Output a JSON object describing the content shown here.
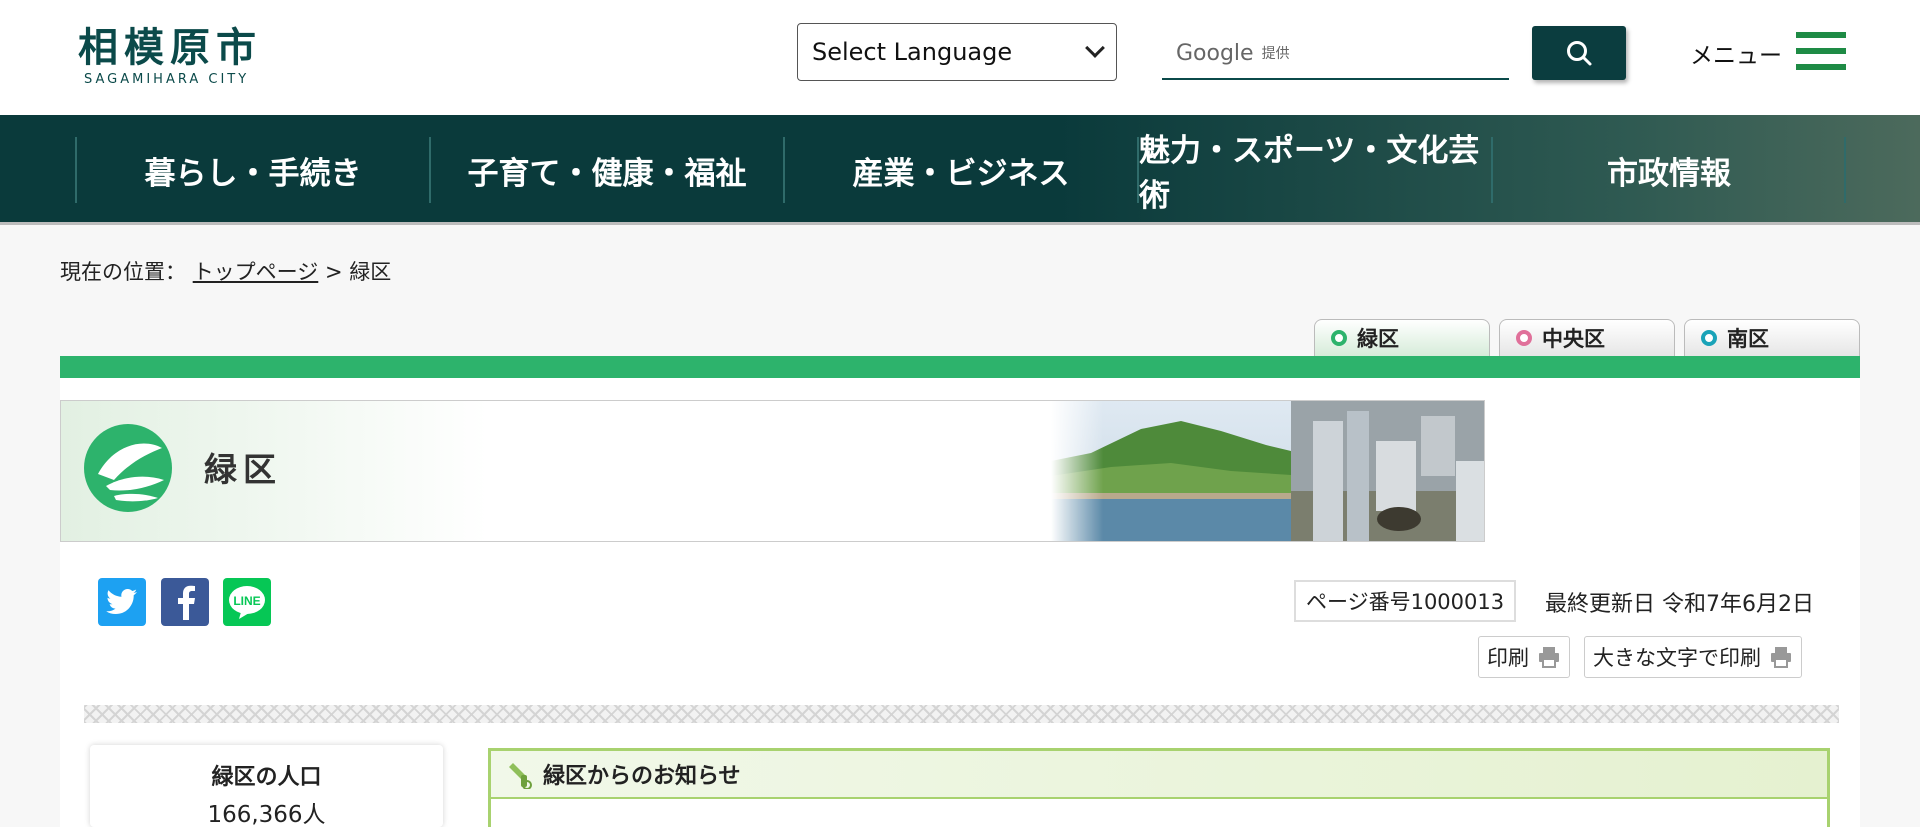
{
  "header": {
    "logo_jp": "相模原市",
    "logo_en": "SAGAMIHARA CITY",
    "language_select": "Select Language",
    "search_brand": "Google",
    "search_provided": "提供",
    "menu_label": "メニュー"
  },
  "nav": {
    "items": [
      {
        "label": "暮らし・手続き"
      },
      {
        "label": "子育て・健康・福祉"
      },
      {
        "label": "産業・ビジネス"
      },
      {
        "label": "魅力・スポーツ・文化芸術"
      },
      {
        "label": "市政情報"
      }
    ]
  },
  "breadcrumb": {
    "prefix": "現在の位置：",
    "top_link": "トップページ",
    "separator": ">",
    "current": "緑区"
  },
  "ward_tabs": [
    {
      "label": "緑区",
      "ring_color": "#2db36c"
    },
    {
      "label": "中央区",
      "ring_color": "#e0709a"
    },
    {
      "label": "南区",
      "ring_color": "#1aa3b8"
    }
  ],
  "banner": {
    "title": "緑区"
  },
  "page_meta": {
    "page_number": "ページ番号1000013",
    "updated": "最終更新日 令和7年6月2日"
  },
  "print": {
    "print_label": "印刷",
    "large_print_label": "大きな文字で印刷"
  },
  "sidebar": {
    "population_title": "緑区の人口",
    "population_value": "166,366人"
  },
  "notice": {
    "title": "緑区からのお知らせ"
  },
  "colors": {
    "brand_dark": "#0b3d3f",
    "accent_green": "#2db36c",
    "twitter": "#1da1f2",
    "facebook": "#3b5998",
    "line": "#06c755"
  }
}
